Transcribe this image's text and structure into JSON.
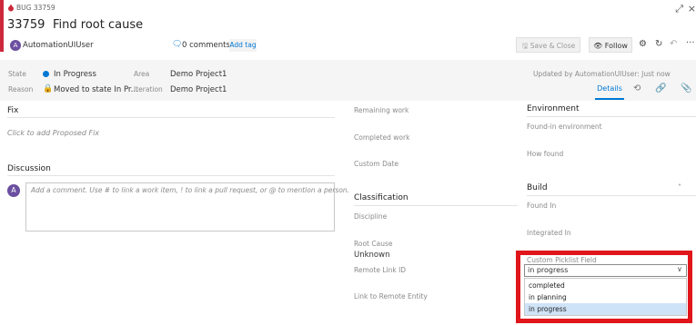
{
  "header": {
    "type_label": "BUG 33759",
    "id": "33759",
    "title": "Find root cause",
    "user": "AutomationUIUser",
    "avatar_initial": "A",
    "comments": "0 comments",
    "add_tag": "Add tag",
    "save_close": "Save & Close",
    "follow": "Follow"
  },
  "state_band": {
    "state_label": "State",
    "state_value": "In Progress",
    "area_label": "Area",
    "area_value": "Demo Project1",
    "reason_label": "Reason",
    "reason_value": "Moved to state In Pr...",
    "iteration_label": "Iteration",
    "iteration_value": "Demo Project1",
    "updated": "Updated by AutomationUIUser: Just now",
    "tab_details": "Details"
  },
  "left": {
    "fix_heading": "Fix",
    "fix_placeholder": "Click to add Proposed Fix",
    "discussion_heading": "Discussion",
    "comment_placeholder": "Add a comment. Use # to link a work item, ! to link a pull request, or @ to mention a person."
  },
  "middle": {
    "remaining_work": "Remaining work",
    "completed_work": "Completed work",
    "custom_date": "Custom Date",
    "classification_heading": "Classification",
    "discipline": "Discipline",
    "root_cause_label": "Root Cause",
    "root_cause_value": "Unknown",
    "remote_link_id": "Remote Link ID",
    "link_to_remote": "Link to Remote Entity"
  },
  "right": {
    "environment_heading": "Environment",
    "found_in_env": "Found-in environment",
    "how_found": "How found",
    "build_heading": "Build",
    "found_in": "Found In",
    "integrated_in": "Integrated In",
    "picklist_label": "Custom Picklist Field",
    "picklist_value": "in progress",
    "options": [
      "completed",
      "in planning",
      "in progress"
    ]
  },
  "colors": {
    "accent": "#cc293d",
    "link": "#0078d4",
    "highlight": "#e0161b"
  }
}
